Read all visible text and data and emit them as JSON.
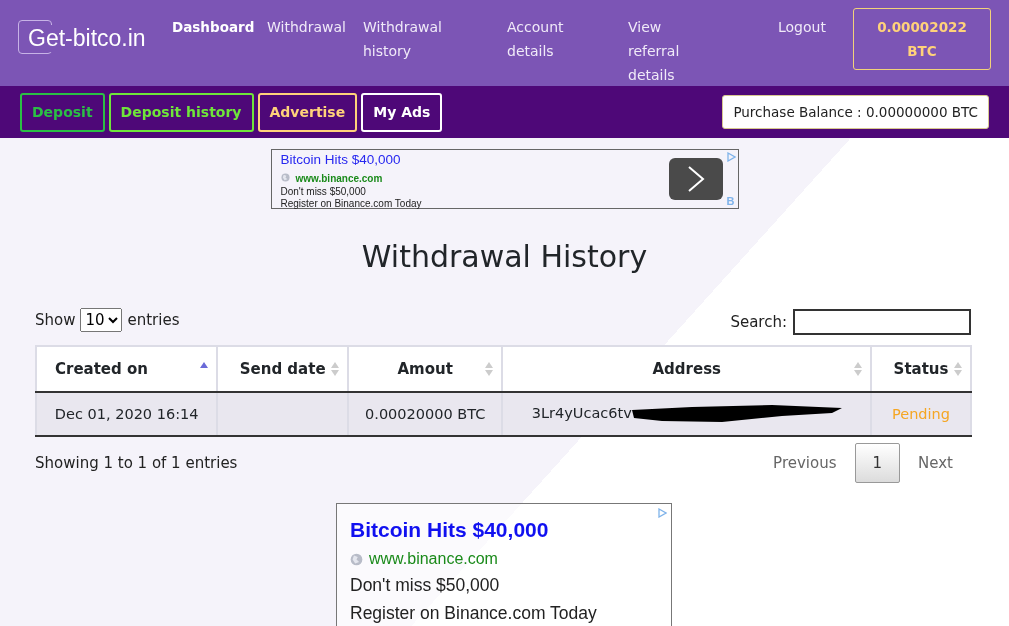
{
  "header": {
    "logo": "Get-bitco.in",
    "nav": [
      {
        "label": "Dashboard",
        "selected": true
      },
      {
        "label": "Withdrawal",
        "selected": false
      },
      {
        "label": "Withdrawal history",
        "selected": false
      },
      {
        "label": "Account details",
        "selected": false
      },
      {
        "label": "View referral details",
        "selected": false
      },
      {
        "label": "Logout",
        "selected": false
      }
    ],
    "balance": "0.00002022 BTC"
  },
  "subnav": {
    "buttons": [
      {
        "label": "Deposit",
        "color": "#2bbf45"
      },
      {
        "label": "Deposit history",
        "color": "#6fe63a"
      },
      {
        "label": "Advertise",
        "color": "#ffd27a"
      },
      {
        "label": "My Ads",
        "color": "#ffffff"
      }
    ],
    "purchase_balance": "Purchase Balance : 0.00000000 BTC"
  },
  "top_ad": {
    "title": "Bitcoin Hits $40,000",
    "url": "www.binance.com",
    "lines": [
      "Don't miss $50,000",
      "Register on Binance.com Today"
    ],
    "badge": "B"
  },
  "page_title": "Withdrawal History",
  "table_controls": {
    "show_label": "Show",
    "page_size": "10",
    "entries_label": "entries",
    "search_label": "Search:"
  },
  "table": {
    "columns": [
      {
        "label": "Created on",
        "sorted_ascending": true
      },
      {
        "label": "Send date",
        "sorted_ascending": false
      },
      {
        "label": "Amout",
        "sorted_ascending": false
      },
      {
        "label": "Address",
        "sorted_ascending": false
      },
      {
        "label": "Status",
        "sorted_ascending": false
      }
    ],
    "rows": [
      {
        "created_on": "Dec 01, 2020 16:14",
        "send_date": "",
        "amount": "0.00020000 BTC",
        "address": "3Lr4yUcac6tv",
        "address_redacted": true,
        "status": "Pending",
        "color": "#f5a623"
      }
    ]
  },
  "info": "Showing 1 to 1 of 1 entries",
  "pagination": {
    "previous": "Previous",
    "pages": [
      {
        "label": "1",
        "selected": true
      }
    ],
    "next": "Next"
  },
  "bottom_ad": {
    "title": "Bitcoin Hits $40,000",
    "url": "www.binance.com",
    "lines": [
      "Don't miss $50,000",
      "Register on Binance.com Today"
    ]
  }
}
